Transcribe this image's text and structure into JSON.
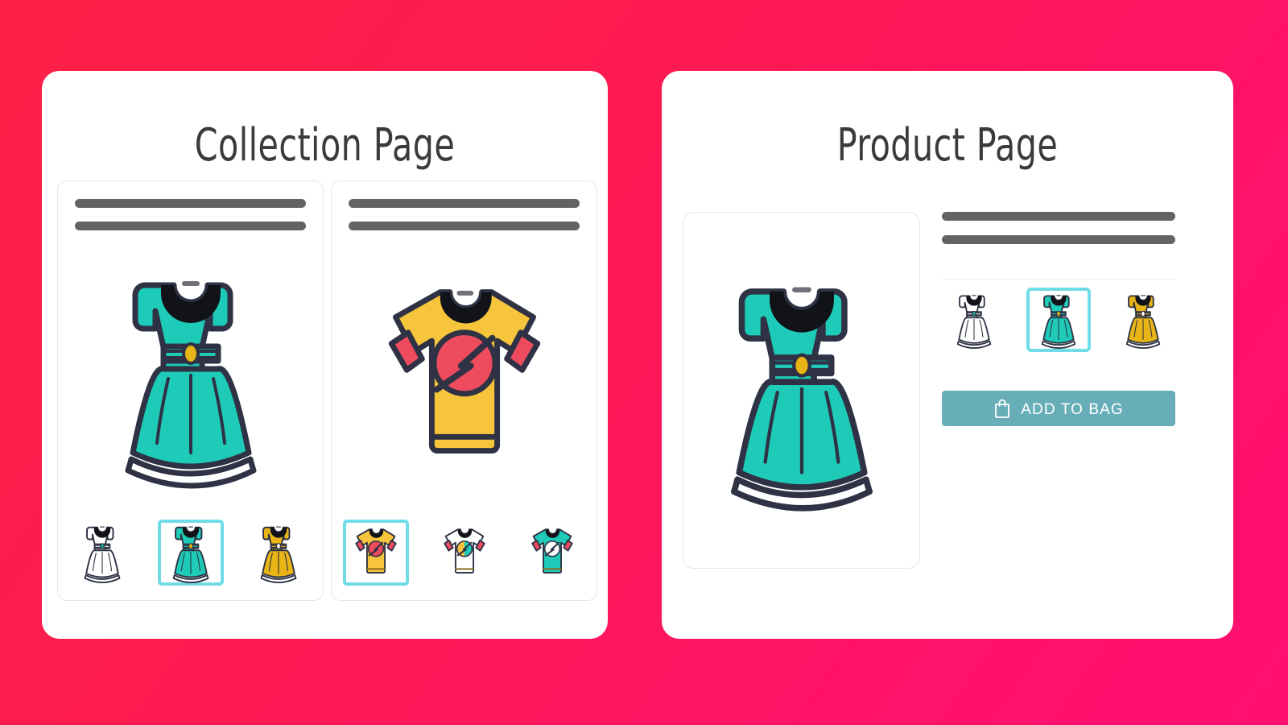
{
  "background": {
    "gradient_from": "#FC2045",
    "gradient_to": "#FF0F72"
  },
  "theme": {
    "teal": "#1ECBB8",
    "outline_navy": "#2E3244",
    "yellow": "#F7C53B",
    "red": "#EE4B5E",
    "gold_buckle": "#E8B416",
    "placeholder_gray": "#636363",
    "selection_cyan": "#6FDCE8",
    "button_teal": "#68AEB8",
    "card_border": "#E6E6E6"
  },
  "collection_page": {
    "title": "Collection Page",
    "products": [
      {
        "name": "dress-product-card",
        "title_placeholder_lines": 2,
        "hero": "teal-dress",
        "variants": [
          {
            "name": "white-dress-thumbnail",
            "color": "white",
            "selected": false
          },
          {
            "name": "teal-dress-thumbnail",
            "color": "teal",
            "selected": true
          },
          {
            "name": "yellow-dress-thumbnail",
            "color": "yellow",
            "selected": false
          }
        ]
      },
      {
        "name": "tshirt-product-card",
        "title_placeholder_lines": 2,
        "hero": "yellow-tshirt",
        "variants": [
          {
            "name": "yellow-tshirt-thumbnail",
            "color": "yellow",
            "selected": true
          },
          {
            "name": "white-tshirt-thumbnail",
            "color": "white",
            "selected": false
          },
          {
            "name": "teal-tshirt-thumbnail",
            "color": "teal",
            "selected": false
          }
        ]
      }
    ]
  },
  "product_page": {
    "title": "Product Page",
    "hero": "teal-dress",
    "title_placeholder_lines": 2,
    "variants": [
      {
        "name": "white-dress-thumbnail",
        "color": "white",
        "selected": false
      },
      {
        "name": "teal-dress-thumbnail",
        "color": "teal",
        "selected": true
      },
      {
        "name": "yellow-dress-thumbnail",
        "color": "yellow",
        "selected": false
      }
    ],
    "add_to_bag_label": "ADD TO BAG",
    "add_to_bag_icon": "shopping-bag-icon"
  }
}
